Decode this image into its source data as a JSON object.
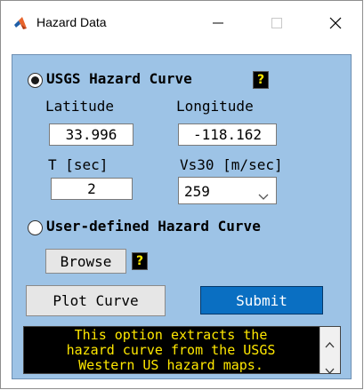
{
  "window": {
    "title": "Hazard Data",
    "app_icon": "matlab-icon",
    "controls": {
      "minimize": "minimize-icon",
      "maximize": "maximize-icon",
      "close": "close-icon"
    }
  },
  "usgs": {
    "label": "USGS Hazard Curve",
    "selected": true,
    "help": "?",
    "latitude_label": "Latitude",
    "longitude_label": "Longitude",
    "latitude_value": "33.996",
    "longitude_value": "-118.162",
    "period_label": "T [sec]",
    "vs30_label": "Vs30 [m/sec]",
    "period_value": "2",
    "vs30_value": "259"
  },
  "user_defined": {
    "label": "User-defined Hazard Curve",
    "selected": false,
    "browse_label": "Browse",
    "help": "?"
  },
  "actions": {
    "plot_label": "Plot Curve",
    "submit_label": "Submit"
  },
  "description": {
    "text": "This option extracts the\nhazard curve from the USGS\nWestern US hazard maps."
  },
  "colors": {
    "panel_bg": "#9dc3e6",
    "submit_bg": "#0a6fc2",
    "help_bg": "#000000",
    "help_fg": "#ffe800"
  }
}
